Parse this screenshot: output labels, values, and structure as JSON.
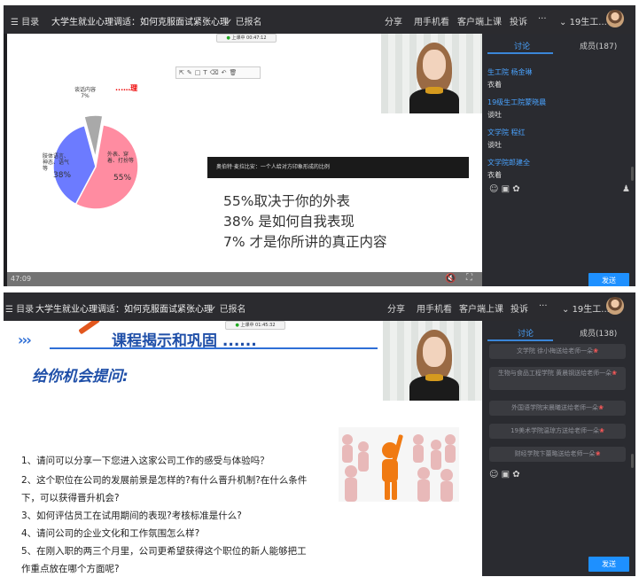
{
  "top1": {
    "menu": "目录",
    "title": "大学生就业心理调适：如何克服面试紧张心理",
    "registered": "已报名",
    "share": "分享",
    "mobile": "用手机看",
    "client": "客户端上课",
    "report": "投诉",
    "more": "···",
    "user": "19生工..."
  },
  "top2": {
    "menu": "目录",
    "title": "大学生就业心理调适：如何克服面试紧张心理",
    "registered": "已报名",
    "share": "分享",
    "mobile": "用手机看",
    "client": "客户端上课",
    "report": "投诉",
    "more": "···",
    "user": "19生工..."
  },
  "slide1": {
    "timer": "上课中 00:47:12",
    "red_text": "...…理",
    "pie_labels": {
      "a_name": "外表、穿着、打扮等",
      "a_pct": "55%",
      "b_name": "肢体语言、神态、语气等",
      "b_pct": "38%",
      "c_name": "谈话内容",
      "c_pct": "7%"
    },
    "banner": "奥伯特·麦拉比安：一个人给对方印象形成的比例",
    "lines": [
      "55%取决于你的外表",
      "38% 是如何自我表现",
      "7% 才是你所讲的真正内容"
    ],
    "time": "47:09"
  },
  "chart_data": {
    "type": "pie",
    "categories": [
      "外表、穿着、打扮等",
      "肢体语言、神态、语气等",
      "谈话内容"
    ],
    "values": [
      55,
      38,
      7
    ]
  },
  "side1": {
    "tab_discuss": "讨论",
    "tab_members": "成员(187)",
    "messages": [
      {
        "name": "生工院 杨金琳",
        "text": "衣着"
      },
      {
        "name": "19级生工院蒙晓晨",
        "text": "谈吐"
      },
      {
        "name": "文学院 程红",
        "text": "谈吐"
      },
      {
        "name": "文学院郎建全",
        "text": "衣着"
      }
    ],
    "send": "发送"
  },
  "slide2": {
    "timer": "上课中 01:45:32",
    "arrows": "›››",
    "heading": "课程揭示和巩固 ......",
    "subheading": "给你机会提问:",
    "questions": [
      "1、请问可以分享一下您进入这家公司工作的感受与体验吗？",
      "2、这个职位在公司的发展前景是怎样的?有什么晋升机制?在什么条件",
      "下，可以获得晋升机会?",
      "3、如何评估员工在试用期间的表现?考核标准是什么?",
      "4、请问公司的企业文化和工作氛围怎么样?",
      "5、在刚入职的两三个月里，公司更希望获得这个职位的新人能够把工",
      "作重点放在哪个方面呢?"
    ]
  },
  "side2": {
    "tab_discuss": "讨论",
    "tab_members": "成员(138)",
    "gifts": [
      "文学院 徐小梅送给老师一朵",
      "生物与食品工程学院 黄晨钢送给老师一朵",
      "外国语学院宋晨曦送给老师一朵",
      "19美术学院温琼方送给老师一朵",
      "财经学院卞蕾略送给老师一朵"
    ],
    "send": "发送"
  }
}
